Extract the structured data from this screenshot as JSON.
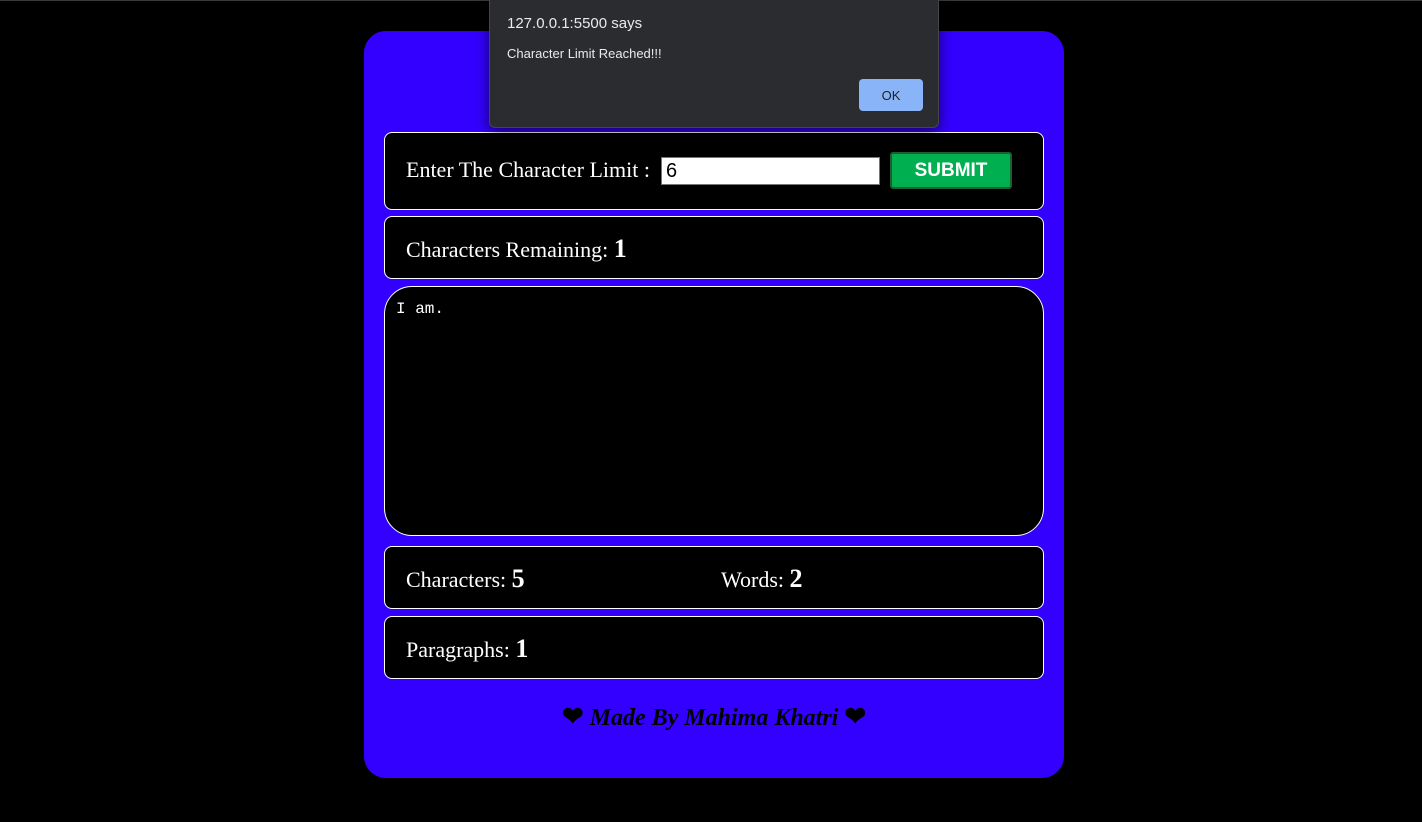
{
  "colors": {
    "page_background": "#000000",
    "card_background": "#3300ff",
    "panel_background": "#000000",
    "submit_button": "#00b050",
    "alert_background": "#2b2c30",
    "alert_ok_button": "#8ab4f8"
  },
  "limit_form": {
    "label": "Enter The Character Limit :",
    "input_value": "6",
    "submit_label": "SUBMIT"
  },
  "remaining": {
    "label": "Characters Remaining:",
    "value": "1"
  },
  "editor": {
    "text": "I am. "
  },
  "counts": {
    "characters_label": "Characters:",
    "characters_value": "5",
    "words_label": "Words:",
    "words_value": "2",
    "paragraphs_label": "Paragraphs:",
    "paragraphs_value": "1"
  },
  "footer": {
    "text": "Made By Mahima Khatri",
    "icon": "heart-icon"
  },
  "alert": {
    "title": "127.0.0.1:5500 says",
    "message": "Character Limit Reached!!!",
    "ok_label": "OK"
  }
}
